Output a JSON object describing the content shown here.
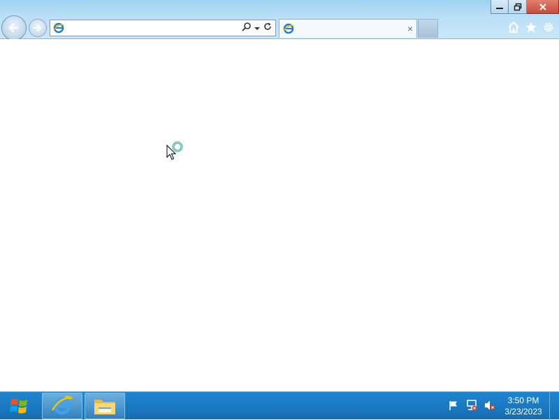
{
  "browser": {
    "address_bar": {
      "value": "",
      "icon": "ie-page-icon"
    },
    "tab": {
      "title": "",
      "icon": "ie-page-icon",
      "close_label": "×"
    },
    "nav": {
      "back_icon": "back-arrow-icon",
      "forward_icon": "forward-arrow-icon"
    },
    "caption": {
      "minimize": "minimize-icon",
      "restore": "restore-icon",
      "close": "close-icon"
    },
    "command_icons": [
      "home-icon",
      "favorites-star-icon",
      "tools-gear-icon"
    ]
  },
  "taskbar": {
    "start": "windows-logo-icon",
    "pinned": [
      "internet-explorer-icon",
      "file-explorer-icon"
    ],
    "tray_icons": [
      "action-center-flag-icon",
      "network-icon",
      "volume-muted-icon"
    ],
    "clock": {
      "time": "3:50 PM",
      "date": "3/23/2023"
    }
  },
  "colors": {
    "taskbar": "#1a7ac2",
    "titlebar": "#b9dff7",
    "close_button": "#c74b3a"
  }
}
